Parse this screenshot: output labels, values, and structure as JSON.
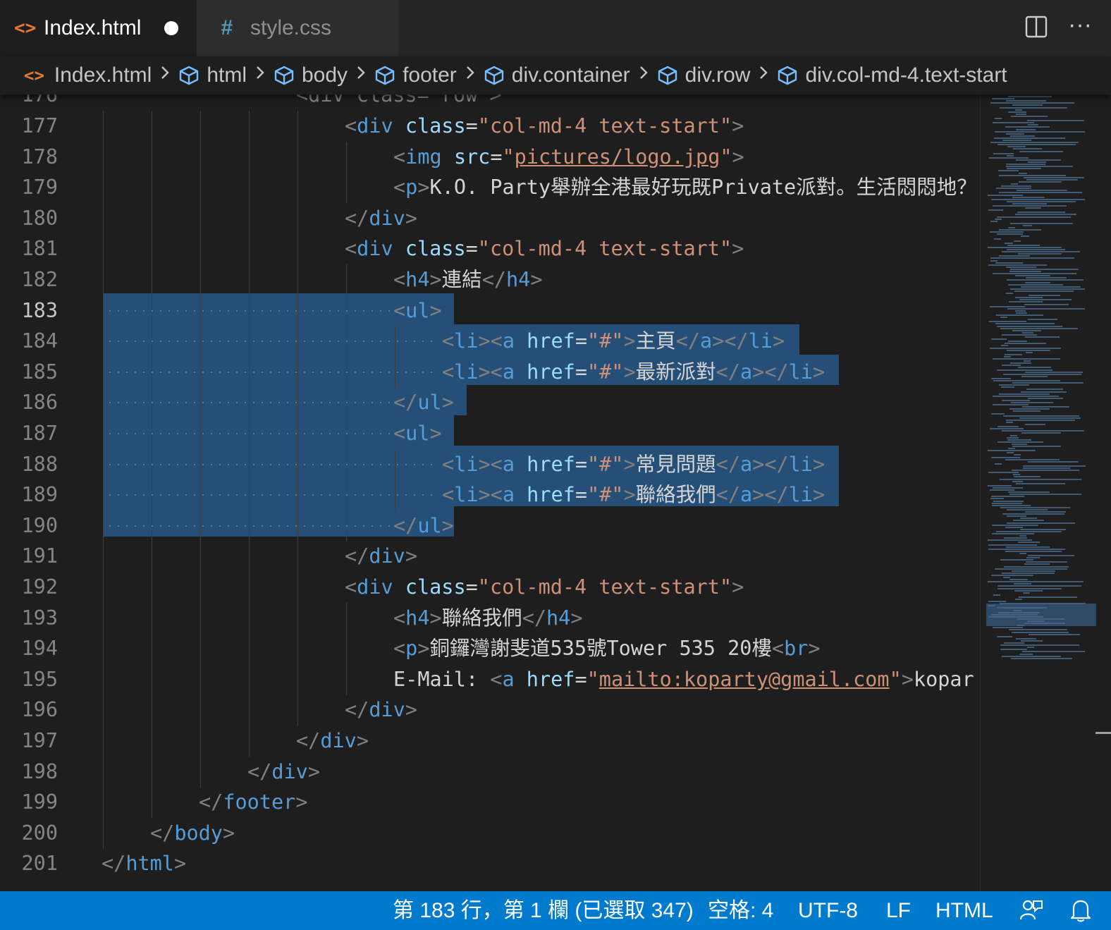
{
  "tabs": [
    {
      "label": "Index.html",
      "active": true,
      "dirty": true
    },
    {
      "label": "style.css",
      "active": false
    }
  ],
  "breadcrumb": [
    "Index.html",
    "html",
    "body",
    "footer",
    "div.container",
    "div.row",
    "div.col-md-4.text-start"
  ],
  "editor": {
    "first_line_partial": {
      "number": "176",
      "text": "<div class=\"row\">"
    },
    "current_line": 183,
    "lines": [
      {
        "n": "177",
        "indent": 6,
        "tokens": [
          [
            "br",
            "<"
          ],
          [
            "tag",
            "div"
          ],
          [
            "txt",
            " "
          ],
          [
            "attr",
            "class"
          ],
          [
            "eq",
            "="
          ],
          [
            "str",
            "\"col-md-4 text-start\""
          ],
          [
            "br",
            ">"
          ]
        ]
      },
      {
        "n": "178",
        "indent": 7,
        "tokens": [
          [
            "br",
            "<"
          ],
          [
            "tag",
            "img"
          ],
          [
            "txt",
            " "
          ],
          [
            "attr",
            "src"
          ],
          [
            "eq",
            "="
          ],
          [
            "str",
            "\""
          ],
          [
            "link",
            "pictures/logo.jpg"
          ],
          [
            "str",
            "\""
          ],
          [
            "br",
            ">"
          ]
        ]
      },
      {
        "n": "179",
        "indent": 7,
        "tokens": [
          [
            "br",
            "<"
          ],
          [
            "tag",
            "p"
          ],
          [
            "br",
            ">"
          ],
          [
            "txt",
            "K.O. Party舉辦全港最好玩既Private派對。生活悶悶地？"
          ]
        ]
      },
      {
        "n": "180",
        "indent": 6,
        "tokens": [
          [
            "br",
            "</"
          ],
          [
            "tag",
            "div"
          ],
          [
            "br",
            ">"
          ]
        ]
      },
      {
        "n": "181",
        "indent": 6,
        "tokens": [
          [
            "br",
            "<"
          ],
          [
            "tag",
            "div"
          ],
          [
            "txt",
            " "
          ],
          [
            "attr",
            "class"
          ],
          [
            "eq",
            "="
          ],
          [
            "str",
            "\"col-md-4 text-start\""
          ],
          [
            "br",
            ">"
          ]
        ]
      },
      {
        "n": "182",
        "indent": 7,
        "tokens": [
          [
            "br",
            "<"
          ],
          [
            "tag",
            "h4"
          ],
          [
            "br",
            ">"
          ],
          [
            "txt",
            "連結"
          ],
          [
            "br",
            "</"
          ],
          [
            "tag",
            "h4"
          ],
          [
            "br",
            ">"
          ]
        ]
      },
      {
        "n": "183",
        "indent": 7,
        "tokens": [
          [
            "br",
            "<"
          ],
          [
            "tag",
            "ul"
          ],
          [
            "br",
            ">"
          ]
        ]
      },
      {
        "n": "184",
        "indent": 8,
        "tokens": [
          [
            "br",
            "<"
          ],
          [
            "tag",
            "li"
          ],
          [
            "br",
            "><"
          ],
          [
            "tag",
            "a"
          ],
          [
            "txt",
            " "
          ],
          [
            "attr",
            "href"
          ],
          [
            "eq",
            "="
          ],
          [
            "str",
            "\"#\""
          ],
          [
            "br",
            ">"
          ],
          [
            "txt",
            "主頁"
          ],
          [
            "br",
            "</"
          ],
          [
            "tag",
            "a"
          ],
          [
            "br",
            "></"
          ],
          [
            "tag",
            "li"
          ],
          [
            "br",
            ">"
          ]
        ]
      },
      {
        "n": "185",
        "indent": 8,
        "tokens": [
          [
            "br",
            "<"
          ],
          [
            "tag",
            "li"
          ],
          [
            "br",
            "><"
          ],
          [
            "tag",
            "a"
          ],
          [
            "txt",
            " "
          ],
          [
            "attr",
            "href"
          ],
          [
            "eq",
            "="
          ],
          [
            "str",
            "\"#\""
          ],
          [
            "br",
            ">"
          ],
          [
            "txt",
            "最新派對"
          ],
          [
            "br",
            "</"
          ],
          [
            "tag",
            "a"
          ],
          [
            "br",
            "></"
          ],
          [
            "tag",
            "li"
          ],
          [
            "br",
            ">"
          ]
        ]
      },
      {
        "n": "186",
        "indent": 7,
        "tokens": [
          [
            "br",
            "</"
          ],
          [
            "tag",
            "ul"
          ],
          [
            "br",
            ">"
          ]
        ]
      },
      {
        "n": "187",
        "indent": 7,
        "tokens": [
          [
            "br",
            "<"
          ],
          [
            "tag",
            "ul"
          ],
          [
            "br",
            ">"
          ]
        ]
      },
      {
        "n": "188",
        "indent": 8,
        "tokens": [
          [
            "br",
            "<"
          ],
          [
            "tag",
            "li"
          ],
          [
            "br",
            "><"
          ],
          [
            "tag",
            "a"
          ],
          [
            "txt",
            " "
          ],
          [
            "attr",
            "href"
          ],
          [
            "eq",
            "="
          ],
          [
            "str",
            "\"#\""
          ],
          [
            "br",
            ">"
          ],
          [
            "txt",
            "常見問題"
          ],
          [
            "br",
            "</"
          ],
          [
            "tag",
            "a"
          ],
          [
            "br",
            "></"
          ],
          [
            "tag",
            "li"
          ],
          [
            "br",
            ">"
          ]
        ]
      },
      {
        "n": "189",
        "indent": 8,
        "tokens": [
          [
            "br",
            "<"
          ],
          [
            "tag",
            "li"
          ],
          [
            "br",
            "><"
          ],
          [
            "tag",
            "a"
          ],
          [
            "txt",
            " "
          ],
          [
            "attr",
            "href"
          ],
          [
            "eq",
            "="
          ],
          [
            "str",
            "\"#\""
          ],
          [
            "br",
            ">"
          ],
          [
            "txt",
            "聯絡我們"
          ],
          [
            "br",
            "</"
          ],
          [
            "tag",
            "a"
          ],
          [
            "br",
            "></"
          ],
          [
            "tag",
            "li"
          ],
          [
            "br",
            ">"
          ]
        ]
      },
      {
        "n": "190",
        "indent": 7,
        "tokens": [
          [
            "br",
            "</"
          ],
          [
            "tag",
            "ul"
          ],
          [
            "br",
            ">"
          ]
        ]
      },
      {
        "n": "191",
        "indent": 6,
        "tokens": [
          [
            "br",
            "</"
          ],
          [
            "tag",
            "div"
          ],
          [
            "br",
            ">"
          ]
        ]
      },
      {
        "n": "192",
        "indent": 6,
        "tokens": [
          [
            "br",
            "<"
          ],
          [
            "tag",
            "div"
          ],
          [
            "txt",
            " "
          ],
          [
            "attr",
            "class"
          ],
          [
            "eq",
            "="
          ],
          [
            "str",
            "\"col-md-4 text-start\""
          ],
          [
            "br",
            ">"
          ]
        ]
      },
      {
        "n": "193",
        "indent": 7,
        "tokens": [
          [
            "br",
            "<"
          ],
          [
            "tag",
            "h4"
          ],
          [
            "br",
            ">"
          ],
          [
            "txt",
            "聯絡我們"
          ],
          [
            "br",
            "</"
          ],
          [
            "tag",
            "h4"
          ],
          [
            "br",
            ">"
          ]
        ]
      },
      {
        "n": "194",
        "indent": 7,
        "tokens": [
          [
            "br",
            "<"
          ],
          [
            "tag",
            "p"
          ],
          [
            "br",
            ">"
          ],
          [
            "txt",
            "銅鑼灣謝斐道535號Tower 535 20樓"
          ],
          [
            "br",
            "<"
          ],
          [
            "tag",
            "br"
          ],
          [
            "br",
            ">"
          ]
        ]
      },
      {
        "n": "195",
        "indent": 7,
        "tokens": [
          [
            "txt",
            "E-Mail: "
          ],
          [
            "br",
            "<"
          ],
          [
            "tag",
            "a"
          ],
          [
            "txt",
            " "
          ],
          [
            "attr",
            "href"
          ],
          [
            "eq",
            "="
          ],
          [
            "str",
            "\""
          ],
          [
            "link",
            "mailto:koparty@gmail.com"
          ],
          [
            "str",
            "\""
          ],
          [
            "br",
            ">"
          ],
          [
            "txt",
            "kopar"
          ]
        ]
      },
      {
        "n": "196",
        "indent": 6,
        "tokens": [
          [
            "br",
            "</"
          ],
          [
            "tag",
            "div"
          ],
          [
            "br",
            ">"
          ]
        ]
      },
      {
        "n": "197",
        "indent": 5,
        "tokens": [
          [
            "br",
            "</"
          ],
          [
            "tag",
            "div"
          ],
          [
            "br",
            ">"
          ]
        ]
      },
      {
        "n": "198",
        "indent": 4,
        "tokens": [
          [
            "br",
            "</"
          ],
          [
            "tag",
            "div"
          ],
          [
            "br",
            ">"
          ]
        ]
      },
      {
        "n": "199",
        "indent": 3,
        "tokens": [
          [
            "br",
            "</"
          ],
          [
            "tag",
            "footer"
          ],
          [
            "br",
            ">"
          ]
        ]
      },
      {
        "n": "200",
        "indent": 2,
        "tokens": [
          [
            "br",
            "</"
          ],
          [
            "tag",
            "body"
          ],
          [
            "br",
            ">"
          ]
        ]
      },
      {
        "n": "201",
        "indent": 1,
        "tokens": [
          [
            "br",
            "</"
          ],
          [
            "tag",
            "html"
          ],
          [
            "br",
            ">"
          ]
        ]
      }
    ]
  },
  "status": {
    "position": "第 183 行，第 1 欄 (已選取 347)",
    "indentation": "空格: 4",
    "encoding": "UTF-8",
    "eol": "LF",
    "language": "HTML"
  },
  "colors": {
    "accent": "#007acc",
    "selection": "#264f78",
    "tag": "#569cd6",
    "attribute": "#9cdcfe",
    "string": "#ce9178",
    "html_icon": "#e37933",
    "css_icon": "#519aba"
  },
  "icons": {
    "tab_html": "html-file-icon",
    "tab_css": "css-file-icon",
    "split": "split-editor-icon",
    "more": "more-actions-icon",
    "crumb_symbol": "symbol-element-icon",
    "feedback": "feedback-icon",
    "bell": "notifications-bell-icon"
  }
}
